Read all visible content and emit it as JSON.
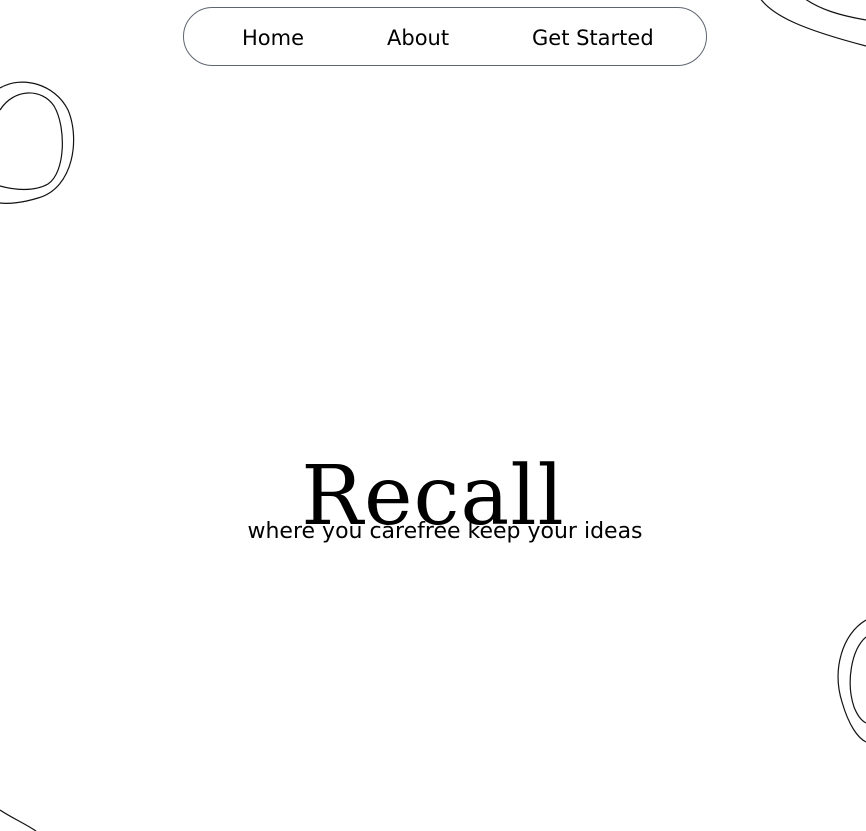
{
  "nav": {
    "items": [
      {
        "label": "Home"
      },
      {
        "label": "About"
      },
      {
        "label": "Get Started"
      }
    ]
  },
  "hero": {
    "title": "Recall",
    "subtitle": "where you carefree keep your ideas"
  }
}
